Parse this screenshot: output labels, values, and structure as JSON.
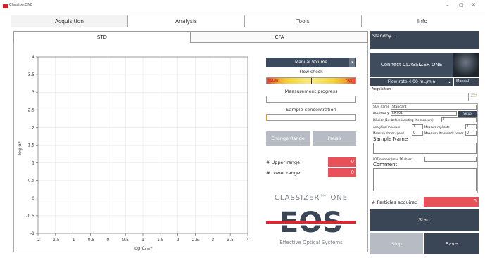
{
  "window": {
    "title": "ClassizerONE",
    "minimize": "–",
    "maximize": "▢",
    "close": "✕"
  },
  "tabs": [
    {
      "label": "Acquisition"
    },
    {
      "label": "Analysis"
    },
    {
      "label": "Tools"
    },
    {
      "label": "Info"
    }
  ],
  "subtabs": [
    {
      "label": "STD"
    },
    {
      "label": "CFA"
    }
  ],
  "chart_data": {
    "type": "line",
    "xlabel": "log Cₑₓₜ*",
    "ylabel": "log α*",
    "xlim": [
      -2,
      4
    ],
    "ylim": [
      -1,
      4
    ],
    "xticks": [
      "-2",
      "-1.5",
      "-1",
      "-0.5",
      "0",
      "0.5",
      "1",
      "1.5",
      "2",
      "2.5",
      "3",
      "3.5",
      "4"
    ],
    "yticks": [
      "-1",
      "-0.5",
      "0",
      "0.5",
      "1",
      "1.5",
      "2",
      "2.5",
      "3",
      "3.5",
      "4"
    ],
    "series": [],
    "grid": true
  },
  "controls": {
    "manual_volume": "Manual Volume",
    "flow_check": "Flow check",
    "slow": "SLOW",
    "fast": "FAST",
    "flow_level": 0.5,
    "measurement_progress": "Measurement progress",
    "sample_concentration": "Sample concentration",
    "change_range": "Change Range",
    "pause": "Pause",
    "upper_range": "# Upper range",
    "upper_value": "0",
    "lower_range": "# Lower range",
    "lower_value": "0",
    "logo_text": "CLASSIZER™ ONE",
    "logo_sub": "Effective Optical Systems",
    "logo_letters": "EOS"
  },
  "right": {
    "status": "Standby...",
    "connect": "Connect CLASSIZER ONE",
    "flow_rate": "Flow rate 4.00 mL/min",
    "manual": "Manual",
    "acquisition": "Acquisition",
    "sop_label": "SOP name",
    "sop_value": "Standard",
    "accessory_label": "Accessory",
    "accessory_value": "LMS01",
    "setup": "Setup",
    "dilution": "Dilution (1x: before inserting the measure)",
    "dilution_value": "1",
    "analytical_measure": "Analytical measure",
    "analytical_value": "1",
    "measure_replicate": "Measure replicate",
    "replicate_value": "1",
    "stirrer_speed": "Measure stirrer speed",
    "stirrer_value": "0",
    "ultrasound": "Measure ultrasounds power",
    "ultrasound_value": "0",
    "sample_name": "Sample Name",
    "lot_label": "LOT number (max 16 chars)",
    "comment": "Comment",
    "particles": "# Particles acquired",
    "particles_value": "0",
    "start": "Start",
    "stop": "Stop",
    "save": "Save"
  }
}
